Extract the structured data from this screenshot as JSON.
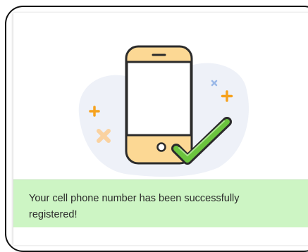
{
  "illustration": {
    "name": "phone-registered-illustration",
    "colors": {
      "blob": "#eef1f8",
      "phone_body": "#fcd894",
      "phone_outline": "#2b2b2b",
      "check_fill": "#6bc43e",
      "accent_orange": "#f6a21e",
      "accent_peach": "#fad2a0",
      "accent_blue": "#9ab8e8"
    }
  },
  "banner": {
    "message": "Your cell phone number has been successfully registered!",
    "background": "#cdf5c4"
  }
}
